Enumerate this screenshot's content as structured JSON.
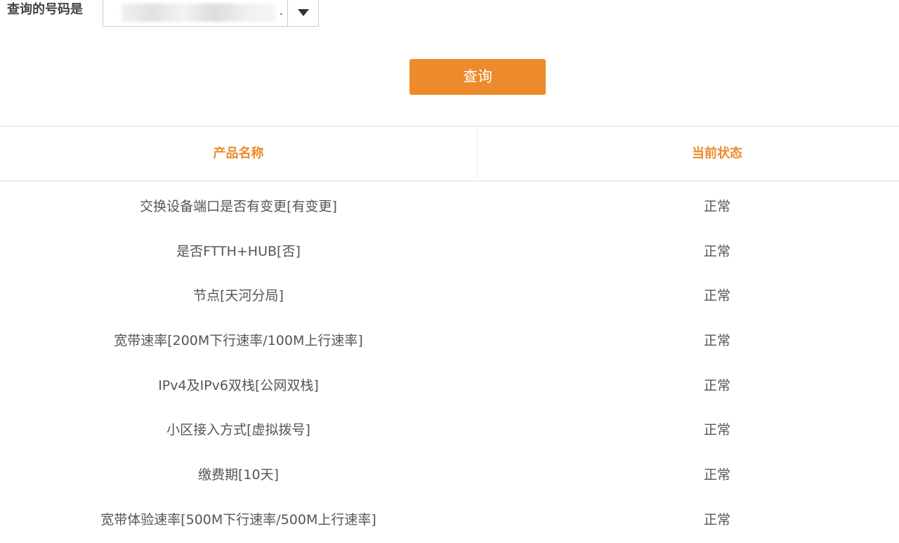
{
  "query": {
    "label": "查询的号码是",
    "number_value": ".",
    "dropdown_icon": "caret-down-icon",
    "button_label": "查询",
    "button_color": "#ec8a2c"
  },
  "table": {
    "header_color": "#ec8a2c",
    "columns": [
      "产品名称",
      "当前状态"
    ],
    "rows": [
      {
        "product": "交换设备端口是否有变更[有变更]",
        "status": "正常"
      },
      {
        "product": "是否FTTH+HUB[否]",
        "status": "正常"
      },
      {
        "product": "节点[天河分局]",
        "status": "正常"
      },
      {
        "product": "宽带速率[200M下行速率/100M上行速率]",
        "status": "正常"
      },
      {
        "product": "IPv4及IPv6双栈[公网双栈]",
        "status": "正常"
      },
      {
        "product": "小区接入方式[虚拟拨号]",
        "status": "正常"
      },
      {
        "product": "缴费期[10天]",
        "status": "正常"
      },
      {
        "product": "宽带体验速率[500M下行速率/500M上行速率]",
        "status": "正常"
      }
    ]
  }
}
